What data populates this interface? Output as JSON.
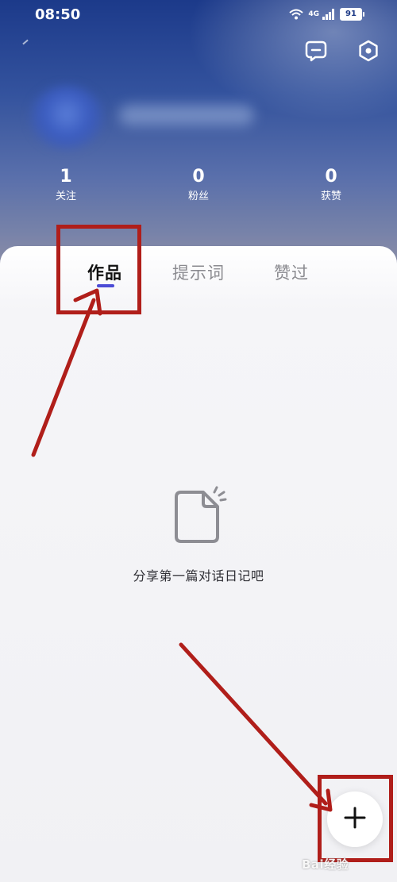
{
  "status_bar": {
    "time": "08:50",
    "network": "4G",
    "battery": "91"
  },
  "profile": {
    "stats": [
      {
        "value": "1",
        "label": "关注"
      },
      {
        "value": "0",
        "label": "粉丝"
      },
      {
        "value": "0",
        "label": "获赞"
      }
    ]
  },
  "tabs": [
    {
      "label": "作品",
      "active": true
    },
    {
      "label": "提示词",
      "active": false
    },
    {
      "label": "赞过",
      "active": false
    }
  ],
  "empty_state": {
    "icon": "document-icon",
    "text": "分享第一篇对话日记吧"
  },
  "fab": {
    "icon": "plus-icon"
  },
  "watermark": "Bai经验",
  "colors": {
    "accent": "#4b4bd6",
    "annotation": "#b01e1a"
  }
}
